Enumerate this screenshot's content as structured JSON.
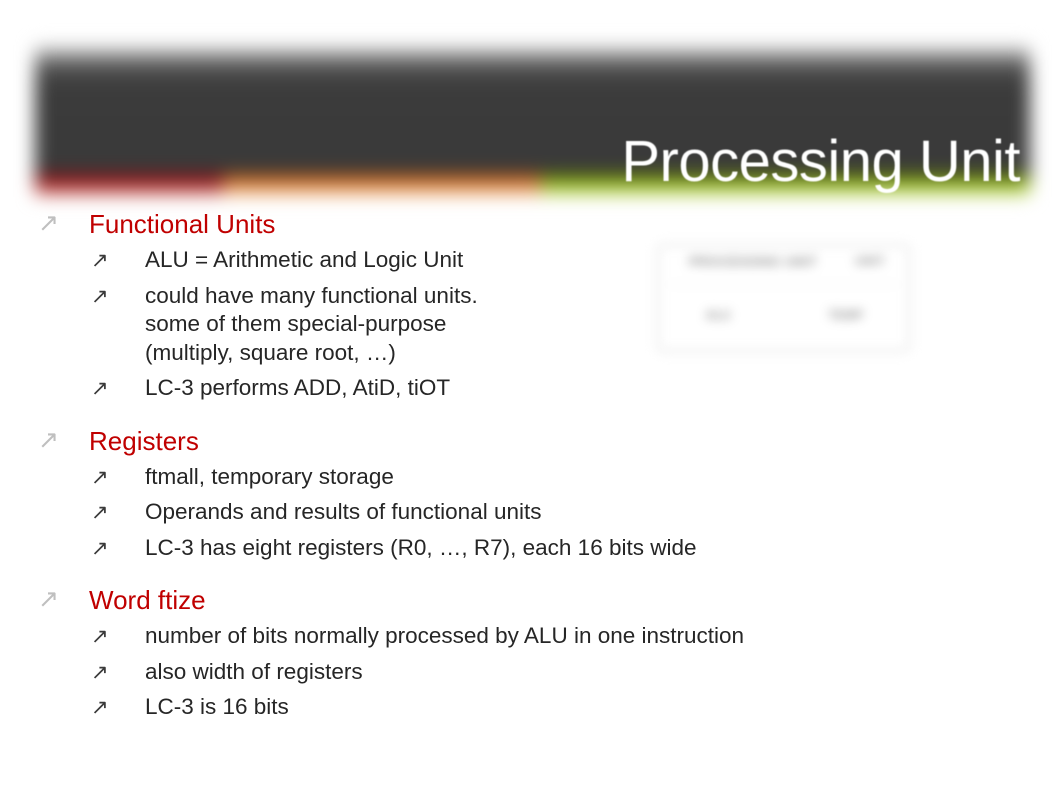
{
  "slide": {
    "title": "Processing Unit",
    "heading_color": "#c00000",
    "body_color": "#262626",
    "banner_stripes": [
      "#8d1b1f",
      "#c2631f",
      "#77950f"
    ]
  },
  "figure": {
    "title": "PROCESSING UNIT",
    "corner": "UNIT",
    "alu": "ALU",
    "temp": "TEMP"
  },
  "bullets": {
    "arrow_level1": "↗",
    "arrow_level2": "↗"
  },
  "sections": [
    {
      "heading": "Functional Units",
      "items": [
        "ALU = Arithmetic and Logic Unit",
        "could have many functional units.\nsome of them special-purpose\n(multiply, square root, …)",
        "LC-3 performs ADD, AtiD, tiOT"
      ]
    },
    {
      "heading": "Registers",
      "items": [
        "ftmall, temporary storage",
        "Operands and results of functional units",
        "LC-3 has eight registers (R0, …, R7), each 16 bits wide"
      ]
    },
    {
      "heading": "Word ftize",
      "items": [
        "number of bits normally processed by ALU in one instruction",
        "also width of registers",
        "LC-3 is 16 bits"
      ]
    }
  ]
}
